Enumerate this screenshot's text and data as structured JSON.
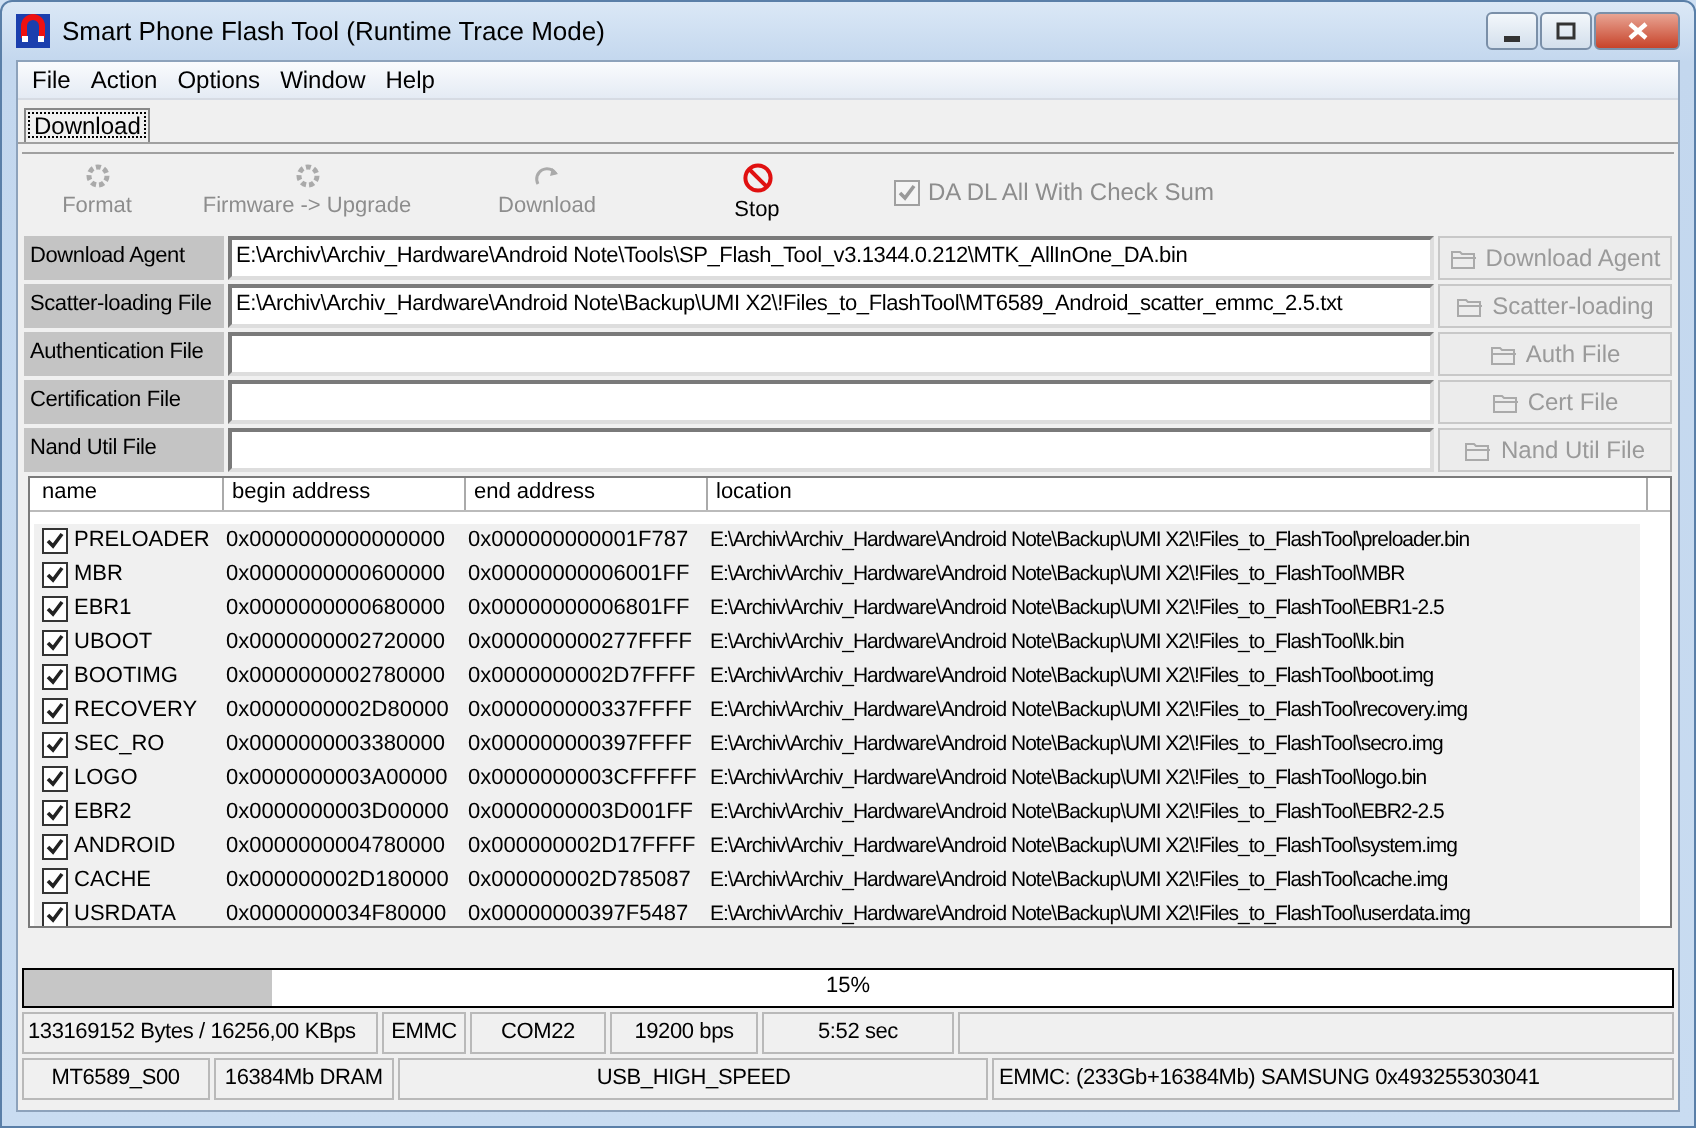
{
  "window": {
    "title": "Smart Phone Flash Tool (Runtime Trace Mode)"
  },
  "menu": [
    "File",
    "Action",
    "Options",
    "Window",
    "Help"
  ],
  "tabs": [
    {
      "label": "Download",
      "selected": true
    }
  ],
  "toolbar": [
    {
      "label": "Format",
      "kind": "gear",
      "disabled": true
    },
    {
      "label": "Firmware -> Upgrade",
      "kind": "gear",
      "disabled": true
    },
    {
      "label": "Download",
      "kind": "redo",
      "disabled": true
    },
    {
      "label": "Stop",
      "kind": "stop",
      "disabled": false
    }
  ],
  "checksum": {
    "label": "DA DL All With Check Sum",
    "checked": true,
    "disabled": true
  },
  "files": [
    {
      "label": "Download Agent",
      "value": "E:\\Archiv\\Archiv_Hardware\\Android Note\\Tools\\SP_Flash_Tool_v3.1344.0.212\\MTK_AllInOne_DA.bin",
      "button": "Download Agent",
      "disabled": true
    },
    {
      "label": "Scatter-loading File",
      "value": "E:\\Archiv\\Archiv_Hardware\\Android Note\\Backup\\UMI X2\\!Files_to_FlashTool\\MT6589_Android_scatter_emmc_2.5.txt",
      "button": "Scatter-loading",
      "disabled": true
    },
    {
      "label": "Authentication File",
      "button": "Auth File",
      "disabled": true
    },
    {
      "label": "Certification File",
      "button": "Cert File",
      "disabled": true
    },
    {
      "label": "Nand Util File",
      "button": "Nand Util File",
      "disabled": true
    }
  ],
  "table": {
    "columns": [
      "name",
      "begin address",
      "end address",
      "location"
    ],
    "rows": [
      {
        "checked": true,
        "name": "PRELOADER",
        "begin": "0x0000000000000000",
        "end": "0x000000000001F787",
        "location": "E:\\Archiv\\Archiv_Hardware\\Android Note\\Backup\\UMI X2\\!Files_to_FlashTool\\preloader.bin"
      },
      {
        "checked": true,
        "name": "MBR",
        "begin": "0x0000000000600000",
        "end": "0x00000000006001FF",
        "location": "E:\\Archiv\\Archiv_Hardware\\Android Note\\Backup\\UMI X2\\!Files_to_FlashTool\\MBR"
      },
      {
        "checked": true,
        "name": "EBR1",
        "begin": "0x0000000000680000",
        "end": "0x00000000006801FF",
        "location": "E:\\Archiv\\Archiv_Hardware\\Android Note\\Backup\\UMI X2\\!Files_to_FlashTool\\EBR1-2.5"
      },
      {
        "checked": true,
        "name": "UBOOT",
        "begin": "0x0000000002720000",
        "end": "0x000000000277FFFF",
        "location": "E:\\Archiv\\Archiv_Hardware\\Android Note\\Backup\\UMI X2\\!Files_to_FlashTool\\lk.bin"
      },
      {
        "checked": true,
        "name": "BOOTIMG",
        "begin": "0x0000000002780000",
        "end": "0x0000000002D7FFFF",
        "location": "E:\\Archiv\\Archiv_Hardware\\Android Note\\Backup\\UMI X2\\!Files_to_FlashTool\\boot.img"
      },
      {
        "checked": true,
        "name": "RECOVERY",
        "begin": "0x0000000002D80000",
        "end": "0x000000000337FFFF",
        "location": "E:\\Archiv\\Archiv_Hardware\\Android Note\\Backup\\UMI X2\\!Files_to_FlashTool\\recovery.img"
      },
      {
        "checked": true,
        "name": "SEC_RO",
        "begin": "0x0000000003380000",
        "end": "0x000000000397FFFF",
        "location": "E:\\Archiv\\Archiv_Hardware\\Android Note\\Backup\\UMI X2\\!Files_to_FlashTool\\secro.img"
      },
      {
        "checked": true,
        "name": "LOGO",
        "begin": "0x0000000003A00000",
        "end": "0x0000000003CFFFFF",
        "location": "E:\\Archiv\\Archiv_Hardware\\Android Note\\Backup\\UMI X2\\!Files_to_FlashTool\\logo.bin"
      },
      {
        "checked": true,
        "name": "EBR2",
        "begin": "0x0000000003D00000",
        "end": "0x0000000003D001FF",
        "location": "E:\\Archiv\\Archiv_Hardware\\Android Note\\Backup\\UMI X2\\!Files_to_FlashTool\\EBR2-2.5"
      },
      {
        "checked": true,
        "name": "ANDROID",
        "begin": "0x0000000004780000",
        "end": "0x000000002D17FFFF",
        "location": "E:\\Archiv\\Archiv_Hardware\\Android Note\\Backup\\UMI X2\\!Files_to_FlashTool\\system.img"
      },
      {
        "checked": true,
        "name": "CACHE",
        "begin": "0x000000002D180000",
        "end": "0x000000002D785087",
        "location": "E:\\Archiv\\Archiv_Hardware\\Android Note\\Backup\\UMI X2\\!Files_to_FlashTool\\cache.img"
      },
      {
        "checked": true,
        "name": "USRDATA",
        "begin": "0x0000000034F80000",
        "end": "0x00000000397F5487",
        "location": "E:\\Archiv\\Archiv_Hardware\\Android Note\\Backup\\UMI X2\\!Files_to_FlashTool\\userdata.img"
      }
    ]
  },
  "progress": {
    "level": 0.15,
    "reading": "15%"
  },
  "status_bar": [
    [
      "133169152 Bytes / 16256,00 KBps",
      "EMMC",
      "COM22",
      "19200 bps",
      "5:52 sec"
    ],
    [
      "MT6589_S00",
      "16384Mb DRAM",
      "USB_HIGH_SPEED",
      "EMMC: (233Gb+16384Mb) SAMSUNG 0x493255303041"
    ]
  ]
}
